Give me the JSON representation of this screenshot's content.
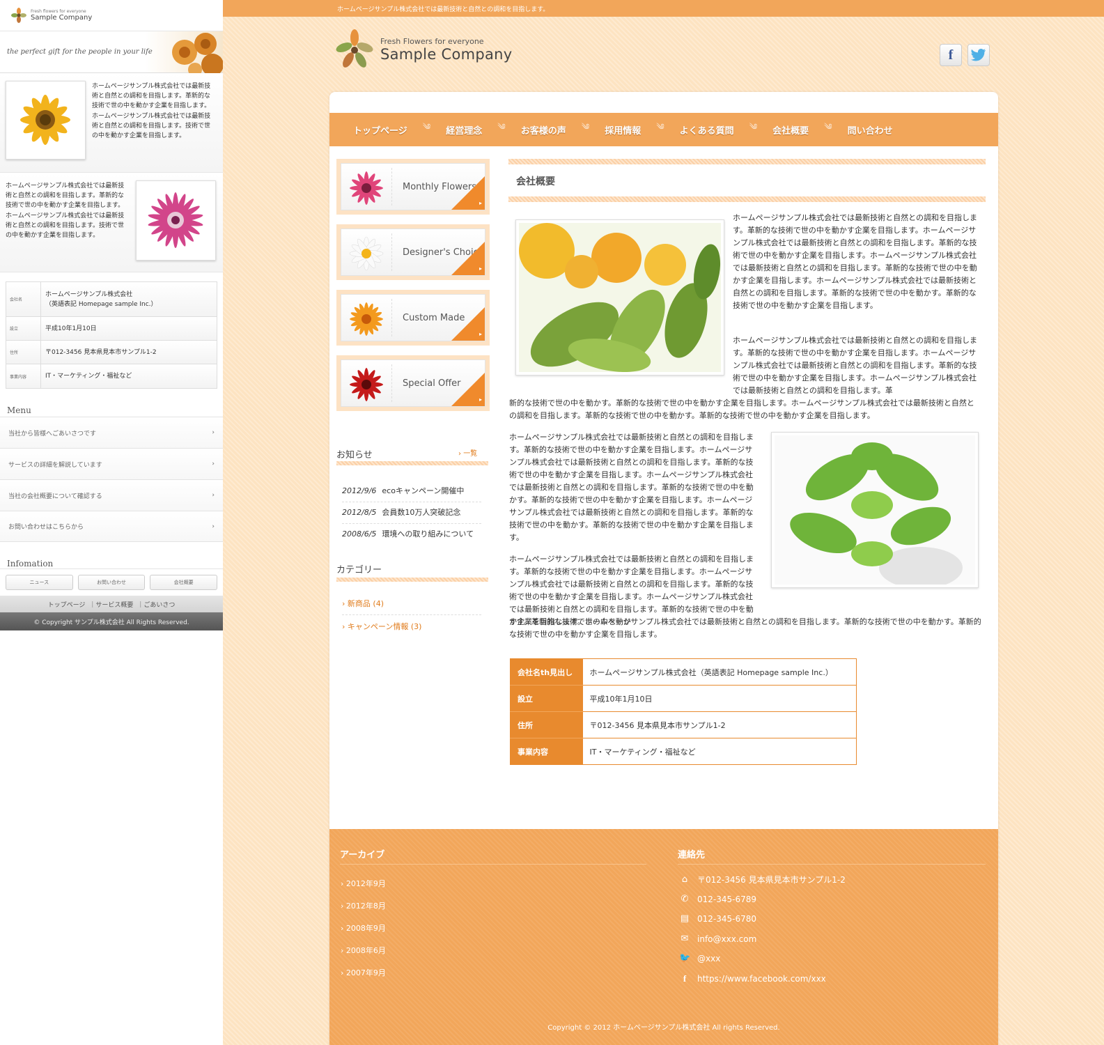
{
  "left": {
    "logo": {
      "tagline": "Fresh flowers for everyone",
      "name": "Sample Company"
    },
    "banner_text": "the perfect gift for the people in your life",
    "intro1": "ホームページサンプル株式会社では最新技術と自然との調和を目指します。革新的な技術で世の中を動かす企業を目指します。ホームページサンプル株式会社では最新技術と自然との調和を目指します。技術で世の中を動かす企業を目指します。",
    "intro2": "ホームページサンプル株式会社では最新技術と自然との調和を目指します。革新的な技術で世の中を動かす企業を目指します。ホームページサンプル株式会社では最新技術と自然との調和を目指します。技術で世の中を動かす企業を目指します。",
    "table": [
      {
        "th": "会社名",
        "td": "ホームページサンプル株式会社\n（英語表記 Homepage sample Inc.）"
      },
      {
        "th": "設立",
        "td": "平成10年1月10日"
      },
      {
        "th": "住所",
        "td": "〒012-3456 見本県見本市サンプル1-2"
      },
      {
        "th": "事業内容",
        "td": "IT・マーケティング・福祉など"
      }
    ],
    "menu_heading": "Menu",
    "menu": [
      "当社から皆様へごあいさつです",
      "サービスの詳細を解説しています",
      "当社の会社概要について確認する",
      "お問い合わせはこちらから"
    ],
    "info_heading": "Infomation",
    "info_buttons": [
      "ニュース",
      "お問い合わせ",
      "会社概要"
    ],
    "foot_links": [
      "トップページ",
      "｜サービス概要",
      "｜ごあいさつ"
    ],
    "copyright": "© Copyright サンプル株式会社 All Rights Reserved."
  },
  "right": {
    "topbar": "ホームページサンプル株式会社では最新技術と自然との調和を目指します。",
    "brand": {
      "tagline": "Fresh Flowers for everyone",
      "name": "Sample Company"
    },
    "nav": [
      "トップページ",
      "経営理念",
      "お客様の声",
      "採用情報",
      "よくある質問",
      "会社概要",
      "問い合わせ"
    ],
    "nav_sep": "༄",
    "cards": [
      "Monthly Flowers",
      "Designer's Choice",
      "Custom Made",
      "Special Offer"
    ],
    "news_heading": "お知らせ",
    "news_more": "一覧",
    "news": [
      {
        "date": "2012/9/6",
        "text": "ecoキャンペーン開催中"
      },
      {
        "date": "2012/8/5",
        "text": "会員数10万人突破記念"
      },
      {
        "date": "2008/6/5",
        "text": "環境への取り組みについて"
      }
    ],
    "category_heading": "カテゴリー",
    "categories": [
      "新商品 (4)",
      "キャンペーン情報 (3)"
    ],
    "content_title": "会社概要",
    "p1": "ホームページサンプル株式会社では最新技術と自然との調和を目指します。革新的な技術で世の中を動かす企業を目指します。ホームページサンプル株式会社では最新技術と自然との調和を目指します。革新的な技術で世の中を動かす企業を目指します。ホームページサンプル株式会社では最新技術と自然との調和を目指します。革新的な技術で世の中を動かす企業を目指します。ホームページサンプル株式会社では最新技術と自然との調和を目指します。革新的な技術で世の中を動かす。革新的な技術で世の中を動かす企業を目指します。",
    "p2a": "ホームページサンプル株式会社では最新技術と自然との調和を目指します。革新的な技術で世の中を動かす企業を目指します。ホームページサンプル株式会社では最新技術と自然との調和を目指します。革新的な技術で世の中を動かす企業を目指します。ホームページサンプル株式会社では最新技術と自然との調和を目指します。革",
    "p2b": "新的な技術で世の中を動かす。革新的な技術で世の中を動かす企業を目指します。ホームページサンプル株式会社では最新技術と自然との調和を目指します。革新的な技術で世の中を動かす。革新的な技術で世の中を動かす企業を目指します。",
    "p3": "ホームページサンプル株式会社では最新技術と自然との調和を目指します。革新的な技術で世の中を動かす企業を目指します。ホームページサンプル株式会社では最新技術と自然との調和を目指します。革新的な技術で世の中を動かす企業を目指します。ホームページサンプル株式会社では最新技術と自然との調和を目指します。革新的な技術で世の中を動かす。革新的な技術で世の中を動かす企業を目指します。ホームページサンプル株式会社では最新技術と自然との調和を目指します。革新的な技術で世の中を動かす。革新的な技術で世の中を動かす企業を目指します。",
    "p4a": "ホームページサンプル株式会社では最新技術と自然との調和を目指します。革新的な技術で世の中を動かす企業を目指します。ホームページサンプル株式会社では最新技術と自然との調和を目指します。革新的な技術で世の中を動かす企業を目指します。ホームページサンプル株式会社では最新技術と自然との調和を目指します。革新的な技術で世の中を動かす。革新的な技術で世の中を動か",
    "p4b": "す企業を目指します。ホームページサンプル株式会社では最新技術と自然との調和を目指します。革新的な技術で世の中を動かす。革新的な技術で世の中を動かす企業を目指します。",
    "table": [
      {
        "th": "会社名th見出し",
        "td": "ホームページサンプル株式会社（英語表記 Homepage sample Inc.）"
      },
      {
        "th": "設立",
        "td": "平成10年1月10日"
      },
      {
        "th": "住所",
        "td": "〒012-3456 見本県見本市サンプル1-2"
      },
      {
        "th": "事業内容",
        "td": "IT・マーケティング・福祉など"
      }
    ],
    "archive_heading": "アーカイブ",
    "archives": [
      "2012年9月",
      "2012年8月",
      "2008年9月",
      "2008年6月",
      "2007年9月"
    ],
    "contact_heading": "連絡先",
    "contacts": [
      {
        "icon": "home-icon",
        "glyph": "⌂",
        "text": "〒012-3456 見本県見本市サンプル1-2"
      },
      {
        "icon": "phone-icon",
        "glyph": "✆",
        "text": "012-345-6789"
      },
      {
        "icon": "fax-icon",
        "glyph": "▤",
        "text": "012-345-6780"
      },
      {
        "icon": "mail-icon",
        "glyph": "✉",
        "text": "info@xxx.com"
      },
      {
        "icon": "twitter-icon",
        "glyph": "🐦",
        "text": "@xxx"
      },
      {
        "icon": "facebook-icon",
        "glyph": "f",
        "text": "https://www.facebook.com/xxx"
      }
    ],
    "copyright": "Copyright © 2012 ホームページサンプル株式会社 All rights Reserved."
  },
  "colors": {
    "accent": "#f2a65a",
    "dark_accent": "#e88a2e",
    "bg": "#fde3c1"
  }
}
